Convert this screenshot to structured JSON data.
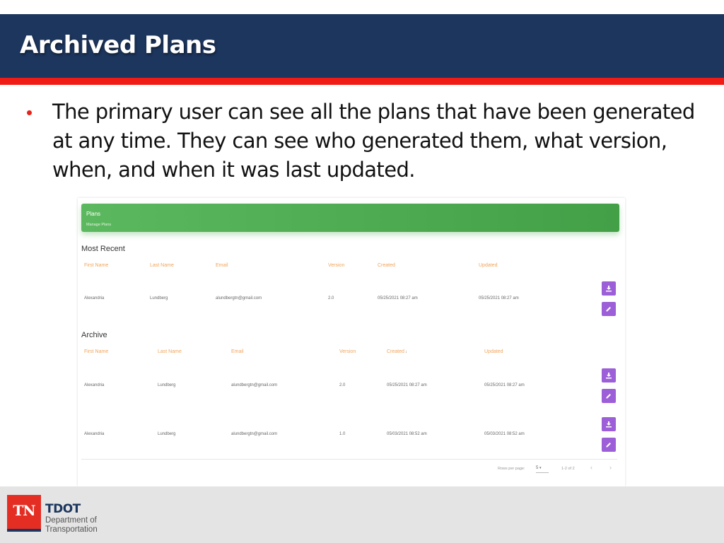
{
  "slide": {
    "title": "Archived Plans",
    "bullet": "The primary user can see all the plans that have been generated at any time. They can see who generated them, what version, when, and when it was last updated."
  },
  "app": {
    "header_title": "Plans",
    "header_subtitle": "Manage Plans",
    "columns": [
      "First Name",
      "Last Name",
      "Email",
      "Version",
      "Created",
      "Updated"
    ],
    "most_recent": {
      "title": "Most Recent",
      "rows": [
        {
          "first": "Alexandria",
          "last": "Lundberg",
          "email": "alundbergtn@gmail.com",
          "version": "2.0",
          "created": "05/25/2021 08:27 am",
          "updated": "05/25/2021 08:27 am"
        }
      ]
    },
    "archive": {
      "title": "Archive",
      "sorted_column": "Created",
      "sort_icon": "↓",
      "rows": [
        {
          "first": "Alexandria",
          "last": "Lundberg",
          "email": "alundbergtn@gmail.com",
          "version": "2.0",
          "created": "05/25/2021 08:27 am",
          "updated": "05/25/2021 08:27 am"
        },
        {
          "first": "Alexandria",
          "last": "Lundberg",
          "email": "alundbergtn@gmail.com",
          "version": "1.0",
          "created": "05/03/2021 08:52 am",
          "updated": "05/03/2021 08:52 am"
        }
      ]
    },
    "actions": {
      "download": "download-icon",
      "edit": "pencil-icon"
    },
    "pagination": {
      "rows_per_page_label": "Rows per page:",
      "rows_per_page": "5",
      "range": "1-2 of 2",
      "prev": "‹",
      "next": "›"
    },
    "colors": {
      "header_green": "#4caf50",
      "column_orange": "#f0a45c",
      "action_purple": "#9c5fd8"
    }
  },
  "footer": {
    "logo_mark": "TN",
    "org": "TDOT",
    "dept_line1": "Department of",
    "dept_line2": "Transportation"
  }
}
